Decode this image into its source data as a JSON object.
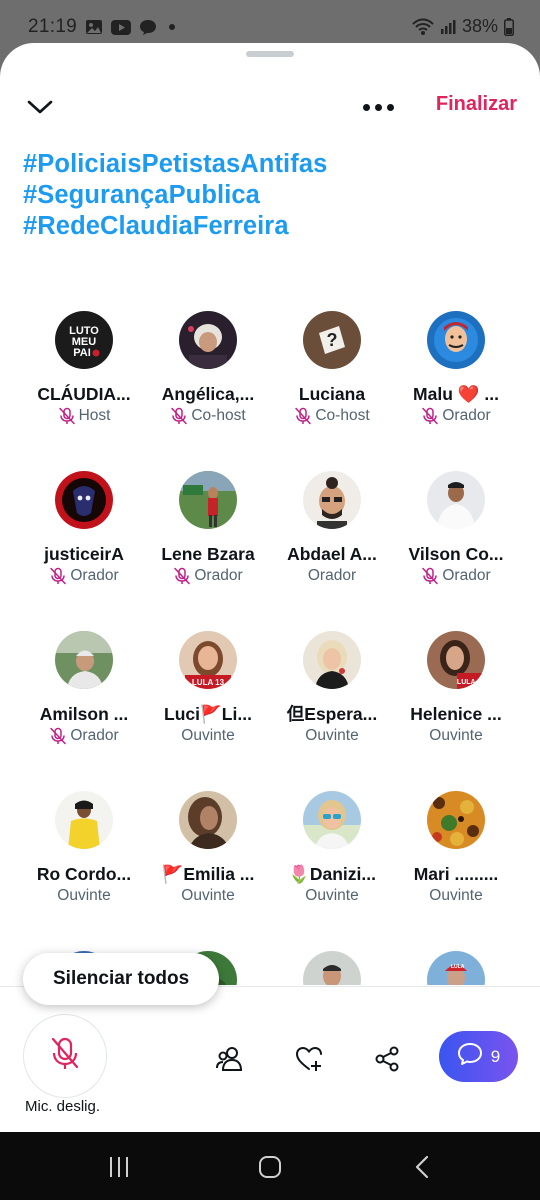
{
  "status_bar": {
    "time": "21:19",
    "battery": "38%",
    "icons": [
      "gallery-icon",
      "youtube-icon",
      "chat-bubble-icon",
      "notification-dot",
      "wifi-icon",
      "signal-icon",
      "battery-icon"
    ]
  },
  "header": {
    "collapse_icon": "chevron-down-icon",
    "more_icon": "more-dots-icon",
    "end_label": "Finalizar"
  },
  "hashtags": [
    "#PoliciaisPetistasAntifas",
    "#SegurançaPublica",
    "#RedeClaudiaFerreira"
  ],
  "participants": [
    {
      "name": "CLÁUDIA...",
      "role": "Host",
      "muted": true,
      "avatar": "black-bg-luto-text"
    },
    {
      "name": "Angélica,...",
      "role": "Co-host",
      "muted": true,
      "avatar": "dark-portrait-white-hair"
    },
    {
      "name": "Luciana",
      "role": "Co-host",
      "muted": true,
      "avatar": "question-mark"
    },
    {
      "name": "Malu ❤️ ...",
      "role": "Orador",
      "muted": true,
      "avatar": "blue-cartoon"
    },
    {
      "name": "justiceirA",
      "role": "Orador",
      "muted": true,
      "avatar": "red-black-badge"
    },
    {
      "name": "Lene Bzara",
      "role": "Orador",
      "muted": true,
      "avatar": "outdoor-woman"
    },
    {
      "name": "Abdael A...",
      "role": "Orador",
      "muted": false,
      "avatar": "man-sunglasses"
    },
    {
      "name": "Vilson Co...",
      "role": "Orador",
      "muted": true,
      "avatar": "man-white-shirt"
    },
    {
      "name": "Amilson ...",
      "role": "Orador",
      "muted": true,
      "avatar": "man-outdoor"
    },
    {
      "name": "Luci🚩Li...",
      "role": "Ouvinte",
      "muted": false,
      "avatar": "woman-lula-13"
    },
    {
      "name": "但Espera...",
      "role": "Ouvinte",
      "muted": false,
      "avatar": "blonde-woman"
    },
    {
      "name": "Helenice ...",
      "role": "Ouvinte",
      "muted": false,
      "avatar": "woman-lula-13-b"
    },
    {
      "name": "Ro Cordo...",
      "role": "Ouvinte",
      "muted": false,
      "avatar": "yellow-shirt"
    },
    {
      "name": "🚩Emilia ...",
      "role": "Ouvinte",
      "muted": false,
      "avatar": "sepia-woman"
    },
    {
      "name": "🌷Danizi...",
      "role": "Ouvinte",
      "muted": false,
      "avatar": "woman-sunglasses"
    },
    {
      "name": "Mari .........",
      "role": "Ouvinte",
      "muted": false,
      "avatar": "jaguar-art"
    },
    {
      "name": "",
      "role": "",
      "muted": false,
      "avatar": "partial-blue"
    },
    {
      "name": "",
      "role": "",
      "muted": false,
      "avatar": "partial-green"
    },
    {
      "name": "",
      "role": "",
      "muted": false,
      "avatar": "military-man"
    },
    {
      "name": "",
      "role": "",
      "muted": false,
      "avatar": "woman-red-cap"
    }
  ],
  "controls": {
    "silence_all_label": "Silenciar todos",
    "mic_label": "Mic. deslig.",
    "chat_count": "9",
    "tools": [
      "people-icon",
      "heart-plus-icon",
      "share-icon",
      "chat-icon"
    ]
  },
  "navigation": [
    "recent-apps-icon",
    "home-icon",
    "back-icon"
  ],
  "colors": {
    "accent_blue": "#1d9bf0",
    "end_red": "#e0245e",
    "mute_magenta": "#c0208a",
    "chat_gradient_start": "#3a55f0",
    "chat_gradient_end": "#7b54ef"
  }
}
